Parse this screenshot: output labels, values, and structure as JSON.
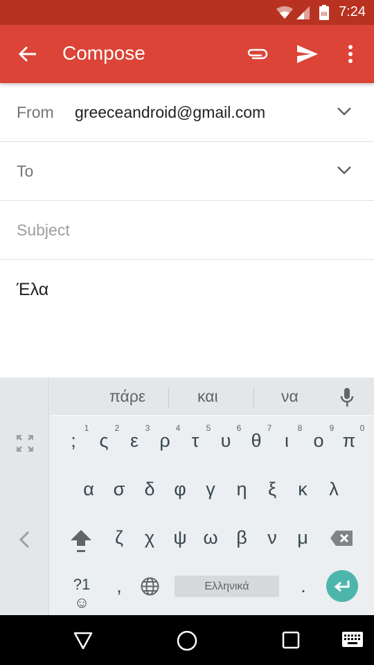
{
  "status_bar": {
    "time": "7:24",
    "battery_label": "88",
    "icons": [
      "wifi-icon",
      "signal-icon",
      "battery-icon"
    ]
  },
  "app_bar": {
    "title": "Compose",
    "actions": [
      "back-arrow-icon",
      "attach-icon",
      "send-icon",
      "more-vert-icon"
    ],
    "color": "#db4437"
  },
  "form": {
    "from_label": "From",
    "from_value": "greeceandroid@gmail.com",
    "to_label": "To",
    "to_value": "",
    "subject_placeholder": "Subject",
    "body_value": "Έλα"
  },
  "keyboard": {
    "suggestions": [
      "πάρε",
      "και",
      "να"
    ],
    "row1": [
      {
        "key": ";",
        "hint": "1"
      },
      {
        "key": "ς",
        "hint": "2"
      },
      {
        "key": "ε",
        "hint": "3"
      },
      {
        "key": "ρ",
        "hint": "4"
      },
      {
        "key": "τ",
        "hint": "5"
      },
      {
        "key": "υ",
        "hint": "6"
      },
      {
        "key": "θ",
        "hint": "7"
      },
      {
        "key": "ι",
        "hint": "8"
      },
      {
        "key": "ο",
        "hint": "9"
      },
      {
        "key": "π",
        "hint": "0"
      }
    ],
    "row2": [
      "α",
      "σ",
      "δ",
      "φ",
      "γ",
      "η",
      "ξ",
      "κ",
      "λ"
    ],
    "row3": [
      "ζ",
      "χ",
      "ψ",
      "ω",
      "β",
      "ν",
      "μ"
    ],
    "symbols_label": "?1☺",
    "comma": ",",
    "space_label": "Ελληνικά",
    "period": ".",
    "enter_color": "#4db6ac"
  },
  "nav_bar": {
    "buttons": [
      "back-triangle-icon",
      "home-circle-icon",
      "recents-square-icon",
      "keyboard-icon"
    ]
  }
}
